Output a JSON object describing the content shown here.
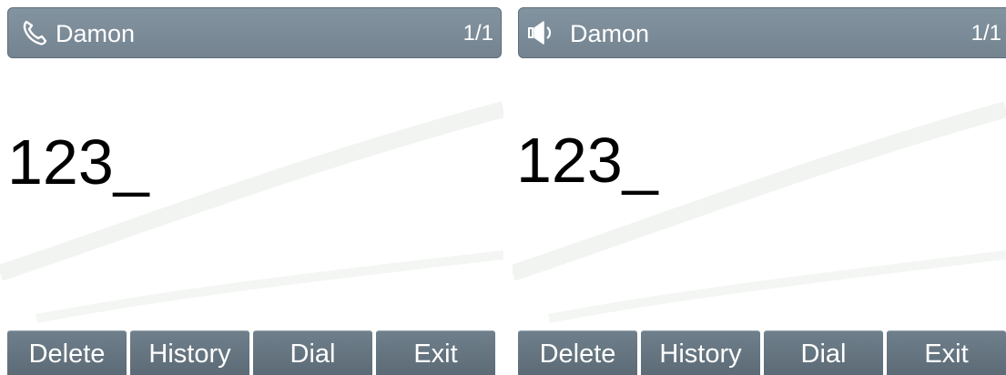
{
  "screens": [
    {
      "line_icon": "handset-icon",
      "title": "Damon",
      "page": "1/1",
      "dial_input": "123_",
      "softkeys": [
        "Delete",
        "History",
        "Dial",
        "Exit"
      ]
    },
    {
      "line_icon": "speaker-icon",
      "title": "Damon",
      "page": "1/1",
      "dial_input": "123_",
      "softkeys": [
        "Delete",
        "History",
        "Dial",
        "Exit"
      ]
    }
  ],
  "colors": {
    "title_bar": "#7b8b97",
    "softkey": "#66757f",
    "text_on_bar": "#ffffff",
    "dial_text": "#000000"
  }
}
